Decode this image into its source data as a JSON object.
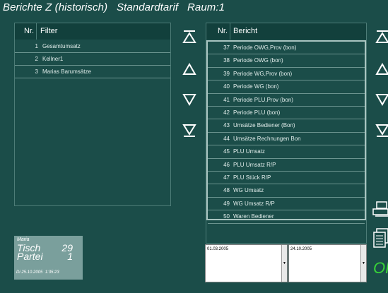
{
  "title": "Berichte Z (historisch)   Standardtarif   Raum:1",
  "filter": {
    "col_nr": "Nr.",
    "col_name": "Filter",
    "rows": [
      {
        "nr": "1",
        "name": "Gesamtumsatz"
      },
      {
        "nr": "2",
        "name": "Kellner1"
      },
      {
        "nr": "3",
        "name": "Marias Barumsätze"
      }
    ]
  },
  "bericht": {
    "col_nr": "Nr.",
    "col_name": "Bericht",
    "rows": [
      {
        "nr": "37",
        "name": "Periode OWG,Prov (bon)"
      },
      {
        "nr": "38",
        "name": "Periode OWG (bon)"
      },
      {
        "nr": "39",
        "name": "Periode WG,Prov (bon)"
      },
      {
        "nr": "40",
        "name": "Periode WG (bon)"
      },
      {
        "nr": "41",
        "name": "Periode PLU,Prov (bon)"
      },
      {
        "nr": "42",
        "name": "Periode PLU (bon)"
      },
      {
        "nr": "43",
        "name": "Umsätze  Bediener (Bon)"
      },
      {
        "nr": "44",
        "name": "Umsätze  Rechnungen Bon"
      },
      {
        "nr": "45",
        "name": "PLU  Umsatz"
      },
      {
        "nr": "46",
        "name": "PLU  Umsatz  R/P"
      },
      {
        "nr": "47",
        "name": "PLU  Stück  R/P"
      },
      {
        "nr": "48",
        "name": "WG  Umsatz"
      },
      {
        "nr": "49",
        "name": "WG  Umsatz  R/P"
      },
      {
        "nr": "50",
        "name": "Waren  Bediener"
      }
    ]
  },
  "info": {
    "user": "Maria",
    "tisch_label": "Tisch",
    "tisch_value": "29",
    "partei_label": "Partei",
    "partei_value": "1",
    "timestamp": "Di 25.10.2005  1:35:23"
  },
  "dates": {
    "from": "01.03.2005",
    "to": "24.10.2005"
  },
  "ok_label": "OK",
  "colors": {
    "background": "#1b4d49",
    "header": "#12403c",
    "selection_border": "#a8c4c0",
    "ok": "#38d438"
  },
  "icons": [
    "scroll-top-icon",
    "scroll-up-icon",
    "scroll-down-icon",
    "scroll-bottom-icon",
    "printer-icon",
    "preview-icon"
  ]
}
